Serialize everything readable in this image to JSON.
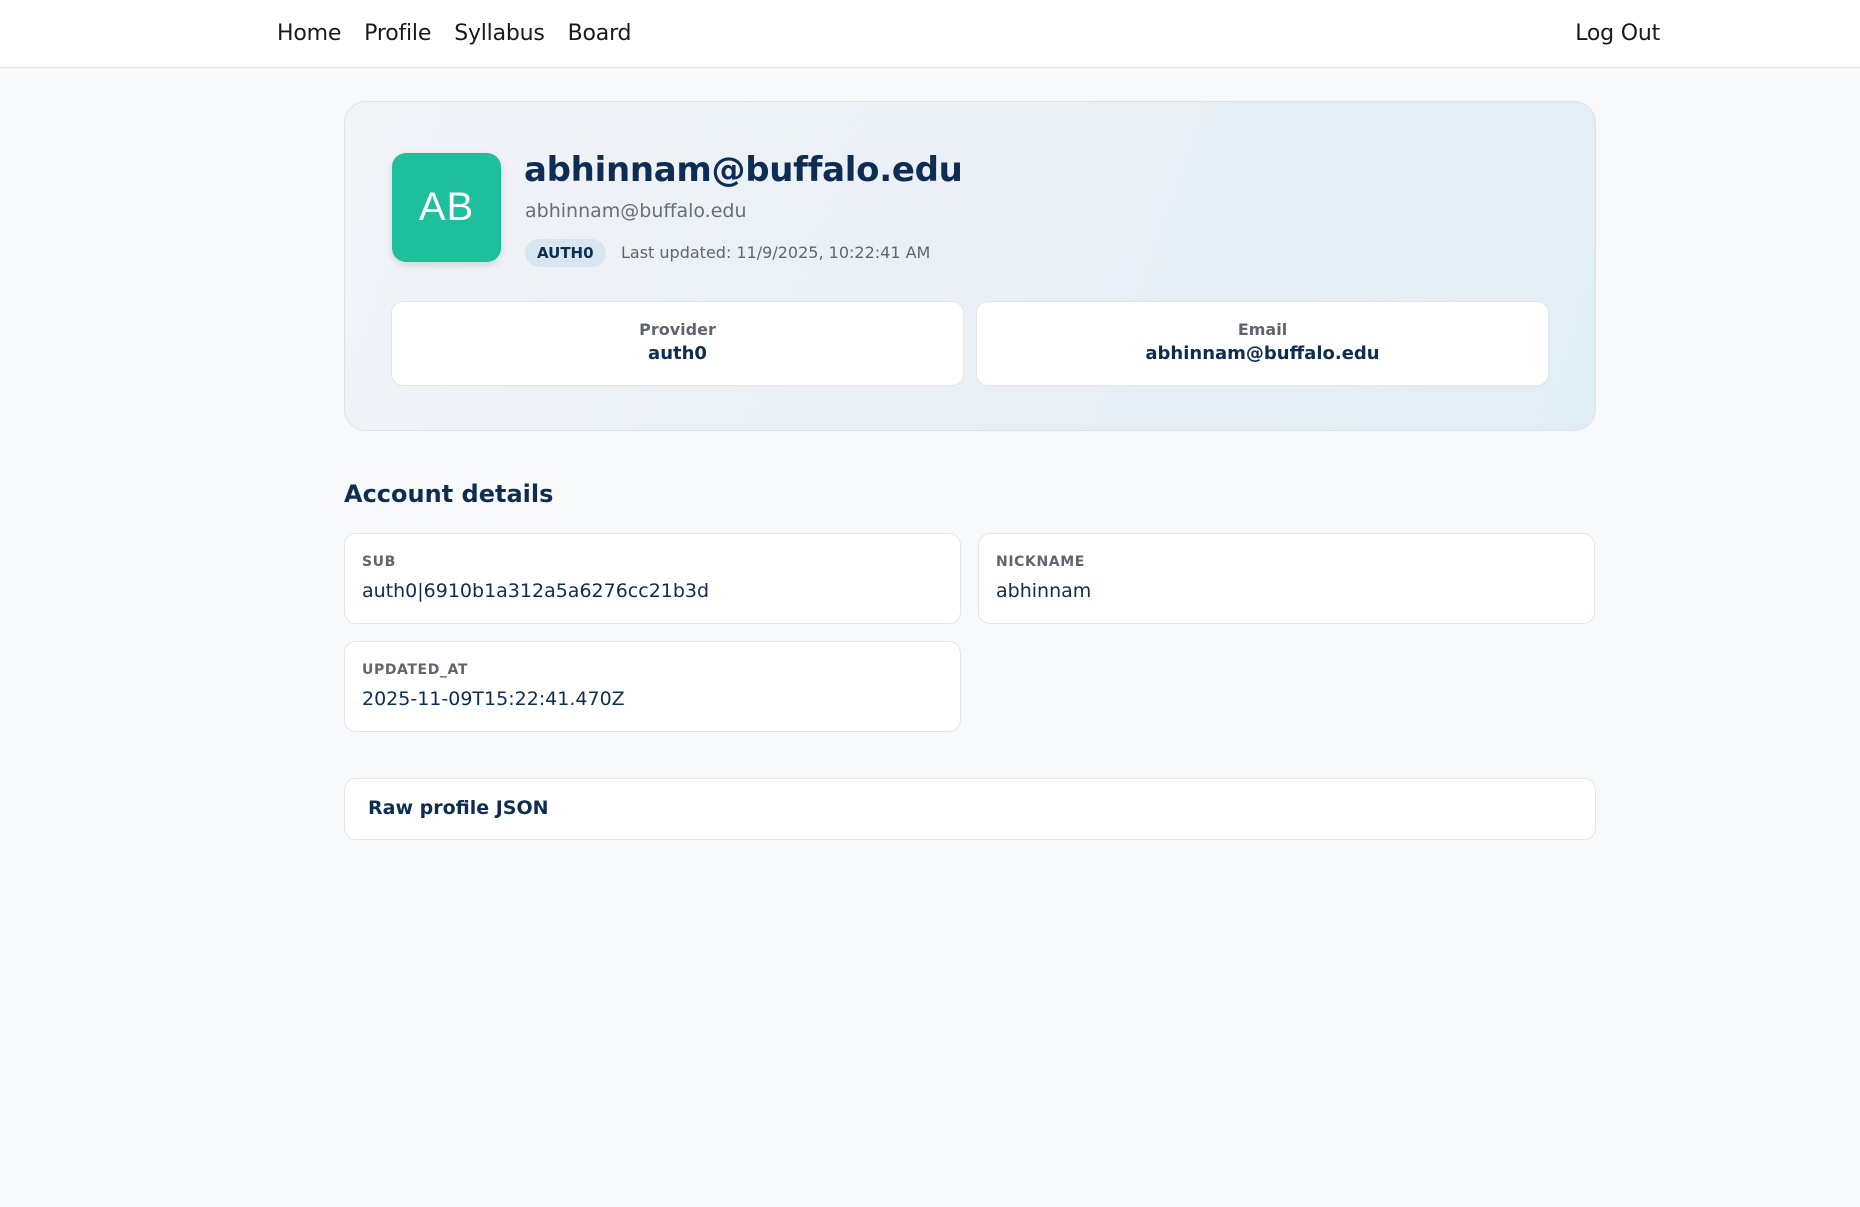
{
  "nav": {
    "links": [
      "Home",
      "Profile",
      "Syllabus",
      "Board"
    ],
    "logout": "Log Out"
  },
  "profile": {
    "initials": "AB",
    "name": "abhinnam@buffalo.edu",
    "email": "abhinnam@buffalo.edu",
    "badge": "AUTH0",
    "last_updated": "Last updated: 11/9/2025, 10:22:41 AM",
    "stats": [
      {
        "label": "Provider",
        "value": "auth0"
      },
      {
        "label": "Email",
        "value": "abhinnam@buffalo.edu"
      }
    ]
  },
  "account": {
    "title": "Account details",
    "fields": [
      {
        "key": "SUB",
        "value": "auth0|6910b1a312a5a6276cc21b3d"
      },
      {
        "key": "NICKNAME",
        "value": "abhinnam"
      },
      {
        "key": "UPDATED_AT",
        "value": "2025-11-09T15:22:41.470Z"
      }
    ]
  },
  "raw": {
    "label": "Raw profile JSON"
  },
  "colors": {
    "avatar": "#1dbf9c",
    "heading": "#0d2d52",
    "page_bg": "#f8f9fb"
  }
}
